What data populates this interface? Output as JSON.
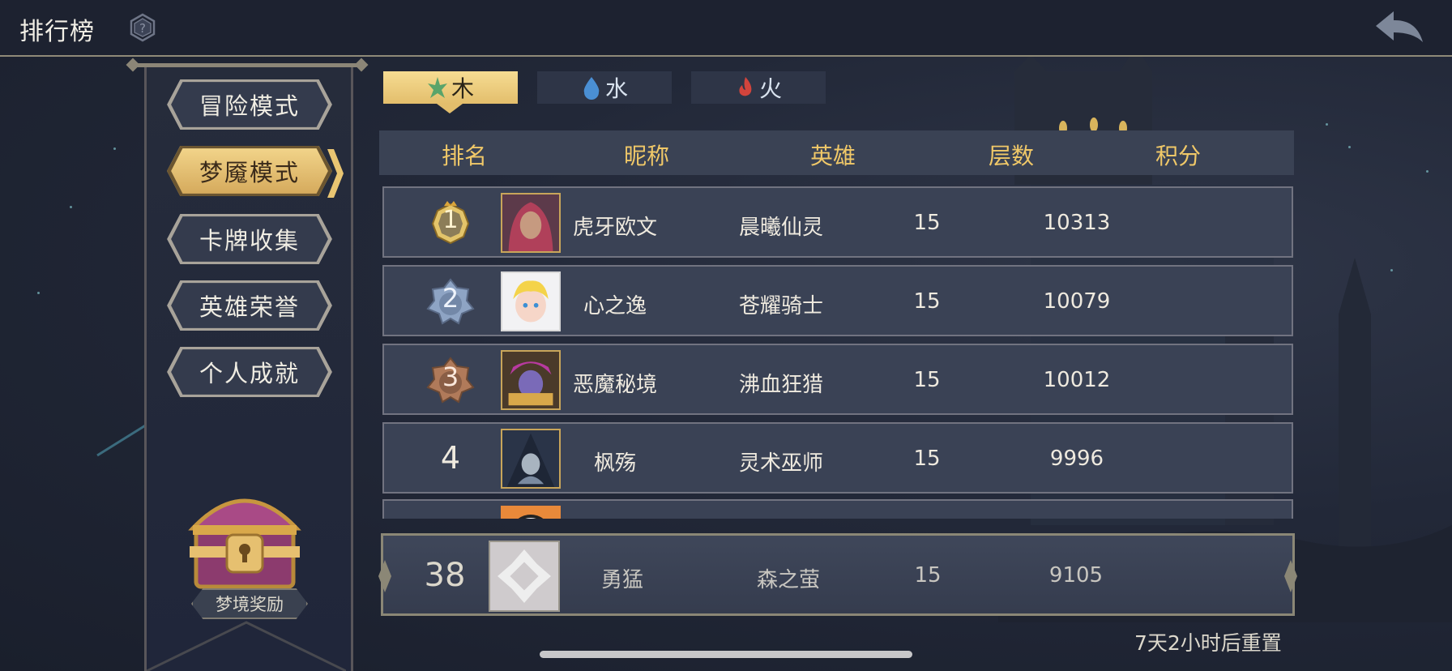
{
  "header": {
    "title": "排行榜",
    "help_icon": "question-hexagon-icon",
    "back_icon": "back-arrow-icon"
  },
  "sidebar": {
    "modes": [
      {
        "label": "冒险模式",
        "active": false
      },
      {
        "label": "梦魇模式",
        "active": true
      },
      {
        "label": "卡牌收集",
        "active": false
      },
      {
        "label": "英雄荣誉",
        "active": false
      },
      {
        "label": "个人成就",
        "active": false
      }
    ],
    "reward_label": "梦境奖励"
  },
  "tabs": [
    {
      "label": "木",
      "icon": "leaf-icon",
      "active": true
    },
    {
      "label": "水",
      "icon": "water-drop-icon",
      "active": false
    },
    {
      "label": "火",
      "icon": "fire-icon",
      "active": false
    }
  ],
  "table": {
    "headers": {
      "rank": "排名",
      "nickname": "昵称",
      "hero": "英雄",
      "floors": "层数",
      "score": "积分"
    },
    "rows": [
      {
        "rank": "1",
        "nickname": "虎牙欧文",
        "hero": "晨曦仙灵",
        "floors": "15",
        "score": "10313"
      },
      {
        "rank": "2",
        "nickname": "心之逸",
        "hero": "苍耀骑士",
        "floors": "15",
        "score": "10079"
      },
      {
        "rank": "3",
        "nickname": "恶魔秘境",
        "hero": "沸血狂猎",
        "floors": "15",
        "score": "10012"
      },
      {
        "rank": "4",
        "nickname": "枫殇",
        "hero": "灵术巫师",
        "floors": "15",
        "score": "9996"
      }
    ]
  },
  "my_entry": {
    "rank": "38",
    "nickname": "勇猛",
    "hero": "森之萤",
    "floors": "15",
    "score": "9105"
  },
  "reset_text": "7天2小时后重置",
  "colors": {
    "gold": "#f0c868",
    "tab_active": "#e3be6c",
    "row_bg": "#3a4255",
    "bg": "#222838"
  }
}
